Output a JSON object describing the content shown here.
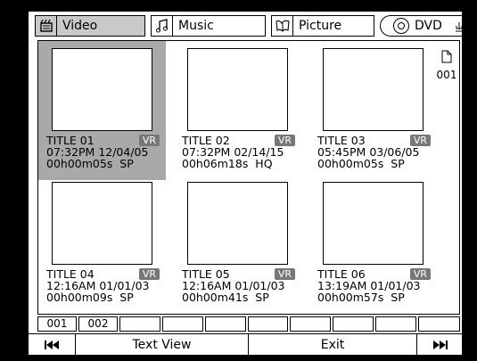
{
  "tabs": [
    {
      "label": "Video",
      "icon": "video-tab-icon",
      "active": true
    },
    {
      "label": "Music",
      "icon": "music-note-icon",
      "active": false
    },
    {
      "label": "Picture",
      "icon": "picture-icon",
      "active": false
    }
  ],
  "source_tab": {
    "label": "DVD",
    "icon": "disc-icon"
  },
  "page_indicator": "001",
  "titles": [
    {
      "name": "TITLE 01",
      "badge": "VR",
      "datetime": "07:32PM 12/04/05",
      "duration": "00h00m05s",
      "mode": "SP",
      "selected": true
    },
    {
      "name": "TITLE 02",
      "badge": "VR",
      "datetime": "07:32PM 02/14/15",
      "duration": "00h06m18s",
      "mode": "HQ",
      "selected": false
    },
    {
      "name": "TITLE 03",
      "badge": "VR",
      "datetime": "05:45PM 03/06/05",
      "duration": "00h00m05s",
      "mode": "SP",
      "selected": false
    },
    {
      "name": "TITLE 04",
      "badge": "VR",
      "datetime": "12:16AM 01/01/03",
      "duration": "00h00m09s",
      "mode": "SP",
      "selected": false
    },
    {
      "name": "TITLE 05",
      "badge": "VR",
      "datetime": "12:16AM 01/01/03",
      "duration": "00h00m41s",
      "mode": "SP",
      "selected": false
    },
    {
      "name": "TITLE 06",
      "badge": "VR",
      "datetime": "13:19AM 01/01/03",
      "duration": "00h00m57s",
      "mode": "SP",
      "selected": false
    }
  ],
  "pages": [
    "001",
    "002",
    "",
    "",
    "",
    "",
    "",
    "",
    "",
    "",
    ""
  ],
  "bottom_bar": {
    "prev_icon": "skip-back-icon",
    "text_view": "Text View",
    "exit": "Exit",
    "next_icon": "skip-forward-icon"
  },
  "colors": {
    "selected_bg": "#a9a9a9",
    "active_tab_bg": "#c9c9c9",
    "badge_bg": "#777777"
  }
}
